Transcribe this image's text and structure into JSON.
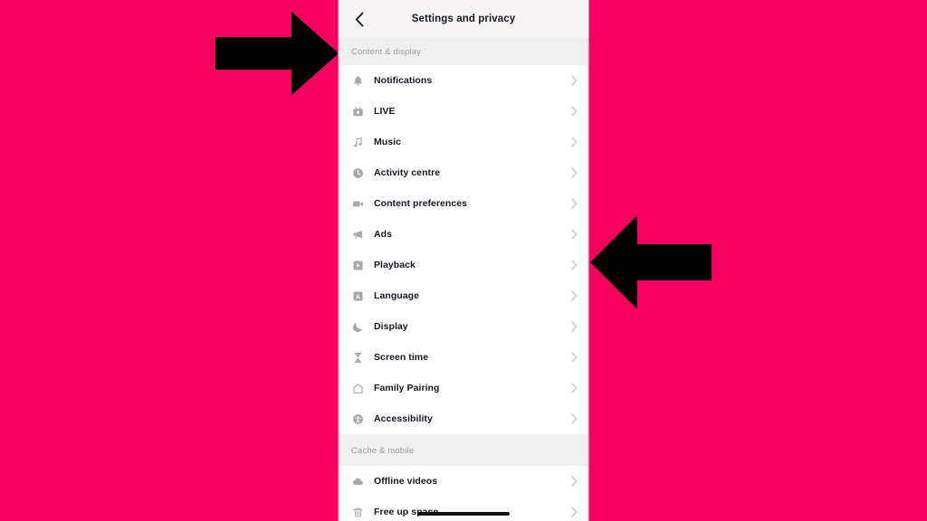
{
  "background": {
    "color": "#F5005E"
  },
  "annotations": {
    "arrows": [
      {
        "name": "arrow-right-pointer",
        "direction": "right",
        "color": "#000000"
      },
      {
        "name": "arrow-left-pointer",
        "direction": "left",
        "color": "#000000"
      }
    ]
  },
  "phone": {
    "topbar": {
      "back_icon": "chevron-left-icon",
      "title": "Settings and privacy"
    },
    "sections": [
      {
        "header": "Content & display",
        "items": [
          {
            "label": "Notifications",
            "icon": "bell-icon",
            "chevron": "chevron-right-icon"
          },
          {
            "label": "LIVE",
            "icon": "live-video-icon",
            "chevron": "chevron-right-icon"
          },
          {
            "label": "Music",
            "icon": "music-note-icon",
            "chevron": "chevron-right-icon"
          },
          {
            "label": "Activity centre",
            "icon": "clock-icon",
            "chevron": "chevron-right-icon"
          },
          {
            "label": "Content preferences",
            "icon": "video-camera-icon",
            "chevron": "chevron-right-icon"
          },
          {
            "label": "Ads",
            "icon": "megaphone-icon",
            "chevron": "chevron-right-icon"
          },
          {
            "label": "Playback",
            "icon": "play-square-icon",
            "chevron": "chevron-right-icon"
          },
          {
            "label": "Language",
            "icon": "letter-a-icon",
            "chevron": "chevron-right-icon"
          },
          {
            "label": "Display",
            "icon": "moon-icon",
            "chevron": "chevron-right-icon"
          },
          {
            "label": "Screen time",
            "icon": "hourglass-icon",
            "chevron": "chevron-right-icon"
          },
          {
            "label": "Family Pairing",
            "icon": "home-icon",
            "chevron": "chevron-right-icon"
          },
          {
            "label": "Accessibility",
            "icon": "accessibility-icon",
            "chevron": "chevron-right-icon"
          }
        ]
      },
      {
        "header": "Cache & mobile",
        "items": [
          {
            "label": "Offline videos",
            "icon": "cloud-download-icon",
            "chevron": "chevron-right-icon"
          },
          {
            "label": "Free up space",
            "icon": "trash-icon",
            "chevron": "chevron-right-icon"
          }
        ]
      }
    ],
    "home_indicator": {
      "name": "home-indicator",
      "color": "#111111"
    }
  }
}
